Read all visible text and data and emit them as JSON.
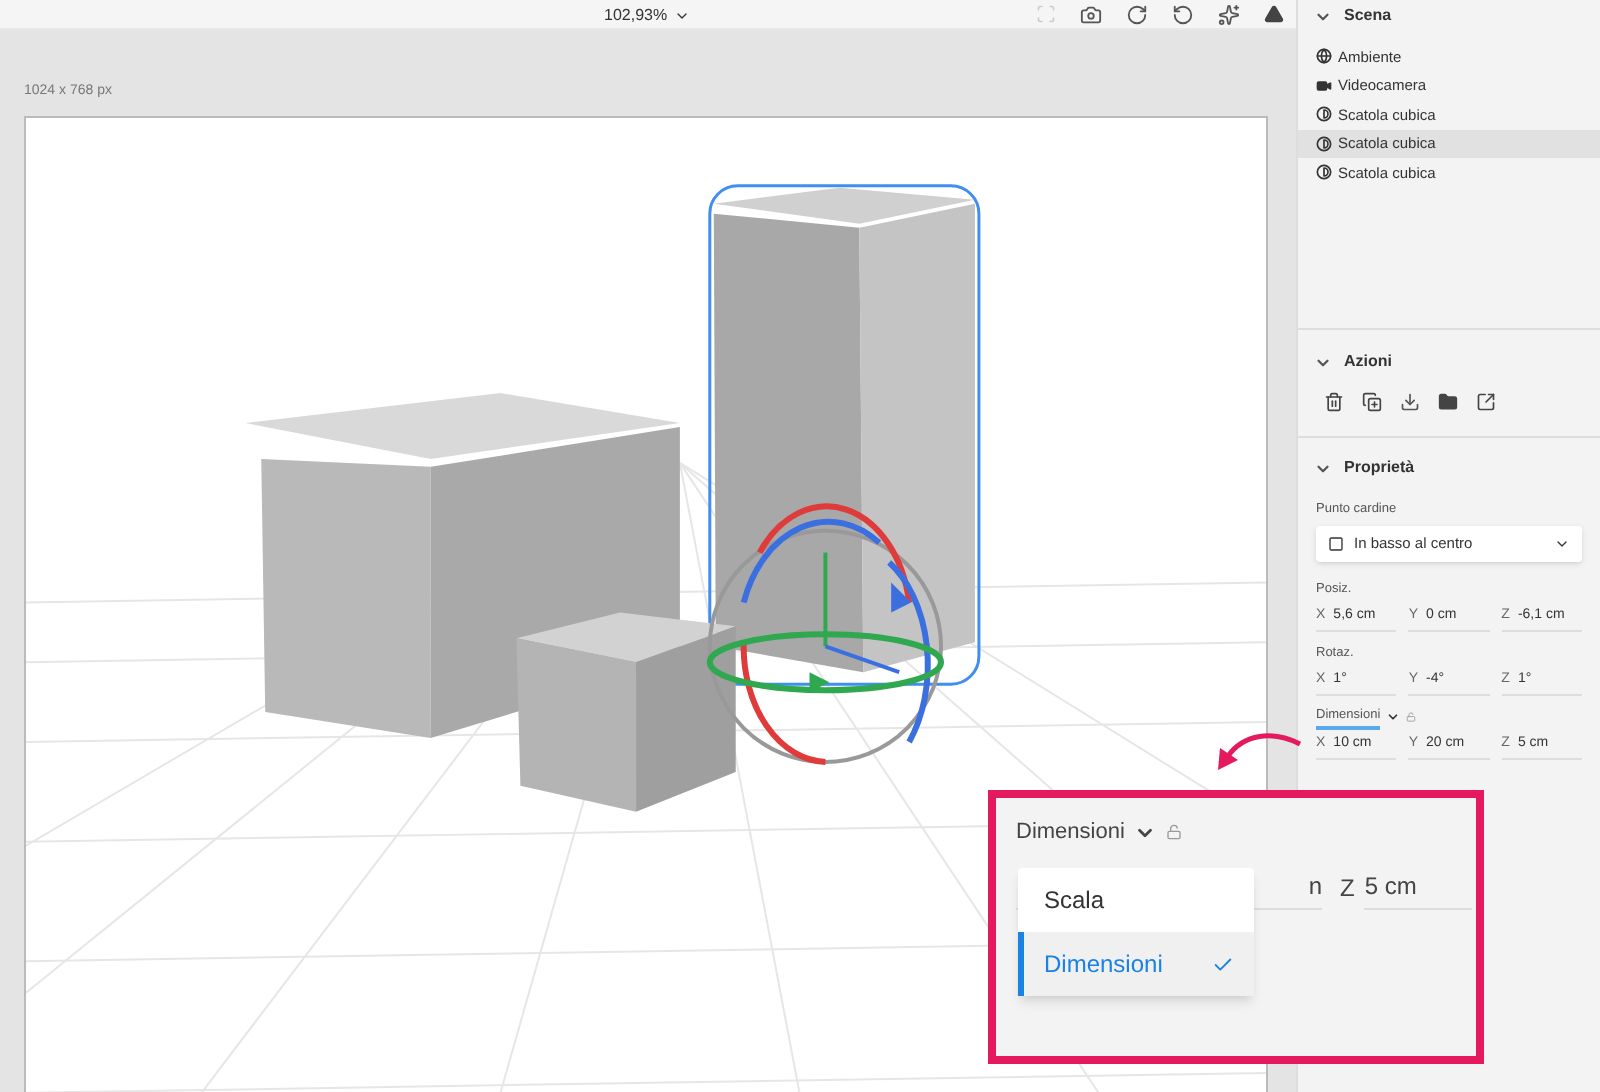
{
  "toolbar": {
    "zoom": "102,93%"
  },
  "canvas": {
    "size_label": "1024 x 768 px"
  },
  "scene": {
    "title": "Scena",
    "expanded": true,
    "items": [
      {
        "label": "Ambiente",
        "kind": "environment",
        "selected": false
      },
      {
        "label": "Videocamera",
        "kind": "camera",
        "selected": false
      },
      {
        "label": "Scatola cubica",
        "kind": "object",
        "selected": false
      },
      {
        "label": "Scatola cubica",
        "kind": "object",
        "selected": true
      },
      {
        "label": "Scatola cubica",
        "kind": "object",
        "selected": false
      }
    ]
  },
  "actions": {
    "title": "Azioni",
    "expanded": true
  },
  "properties": {
    "title": "Proprietà",
    "expanded": true,
    "anchor": {
      "label": "Punto cardine",
      "value": "In basso al centro"
    },
    "groups": [
      {
        "label": "Posiz.",
        "kind": "plain",
        "active": false,
        "fields": [
          {
            "axis": "X",
            "value": "5,6 cm"
          },
          {
            "axis": "Y",
            "value": "0 cm"
          },
          {
            "axis": "Z",
            "value": "-6,1 cm"
          }
        ]
      },
      {
        "label": "Rotaz.",
        "kind": "plain",
        "active": false,
        "fields": [
          {
            "axis": "X",
            "value": "1°"
          },
          {
            "axis": "Y",
            "value": "-4°"
          },
          {
            "axis": "Z",
            "value": "1°"
          }
        ]
      },
      {
        "label": "Dimensioni",
        "kind": "dropdown",
        "active": true,
        "fields": [
          {
            "axis": "X",
            "value": "10 cm"
          },
          {
            "axis": "Y",
            "value": "20 cm"
          },
          {
            "axis": "Z",
            "value": "5 cm"
          }
        ]
      }
    ]
  },
  "callout": {
    "label": "Dimensioni",
    "partial_value": "n",
    "field": {
      "axis": "Z",
      "value": "5 cm"
    },
    "menu": [
      {
        "label": "Scala",
        "selected": false
      },
      {
        "label": "Dimensioni",
        "selected": true
      }
    ]
  }
}
